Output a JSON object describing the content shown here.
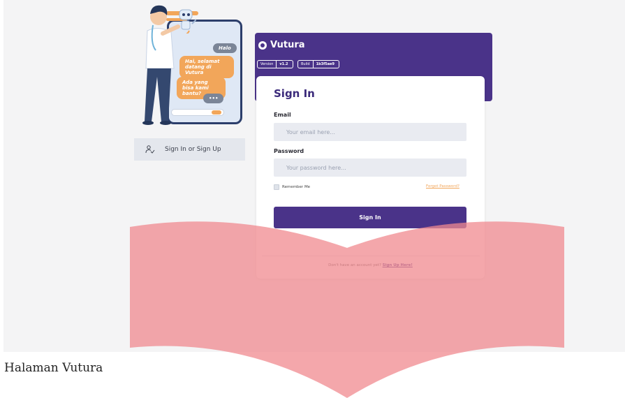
{
  "illustration": {
    "bubbles": [
      "Halo",
      "Hai, selamat datang di Vutura",
      "Ada yang bisa kami bantu?",
      "•••"
    ]
  },
  "sidebar": {
    "items": [
      {
        "label": "Sign In or Sign Up",
        "icon": "user-check-icon"
      }
    ]
  },
  "header": {
    "brand": "Vutura",
    "version_key": "Version",
    "version_value": "v1.2",
    "build_key": "Build",
    "build_value": "1b3f5ae9"
  },
  "form": {
    "title": "Sign In",
    "email_label": "Email",
    "email_placeholder": "Your email here...",
    "password_label": "Password",
    "password_placeholder": "Your password here...",
    "remember_label": "Remember Me",
    "forgot_label": "Forgot Password?",
    "submit_label": "Sign In",
    "signup_prompt": "Don't have an account yet?",
    "signup_link": "Sign Up Here!"
  },
  "caption": "Halaman Vutura",
  "colors": {
    "primary": "#4a3389",
    "accent": "#f2a65a",
    "overlay": "#f08a8f"
  }
}
